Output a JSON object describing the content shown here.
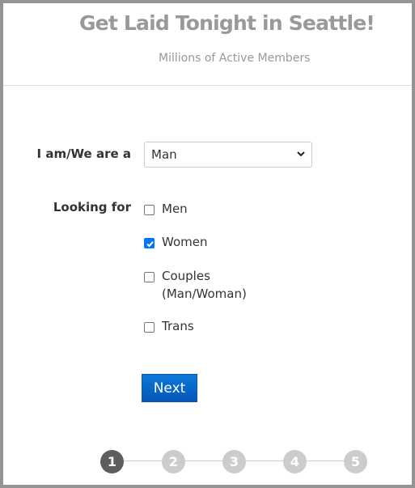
{
  "header": {
    "title": "Get Laid Tonight in Seattle!",
    "subtitle": "Millions of Active Members"
  },
  "form": {
    "iam_label": "I am/We are a",
    "iam_select": {
      "selected": "Man",
      "icon": "chevron-down-icon"
    },
    "looking_label": "Looking for",
    "options": [
      {
        "label": "Men",
        "checked": false
      },
      {
        "label": "Women",
        "checked": true
      },
      {
        "label": "Couples (Man/Woman)",
        "line1": "Couples",
        "line2": "(Man/Woman)",
        "checked": false
      },
      {
        "label": "Trans",
        "checked": false
      }
    ],
    "next_label": "Next"
  },
  "steps": {
    "current": 1,
    "items": [
      "1",
      "2",
      "3",
      "4",
      "5"
    ]
  },
  "colors": {
    "accent": "#0075ff",
    "button": "#0656b8",
    "step_active": "#5e5e5e",
    "step_inactive": "#cccccc"
  }
}
